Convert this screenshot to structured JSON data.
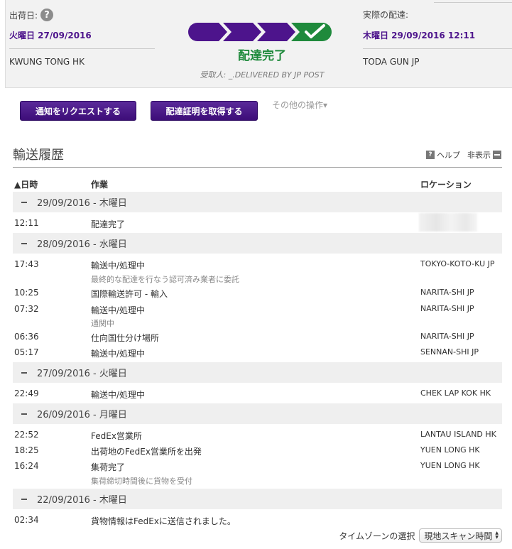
{
  "summary": {
    "ship_label": "出荷日:",
    "ship_date": "火曜日 27/09/2016",
    "origin": "KWUNG TONG HK",
    "actual_label": "実際の配達:",
    "delivery_date": "木曜日 29/09/2016 12:11",
    "destination": "TODA GUN JP",
    "status": "配達完了",
    "recipient": "受取人: _.DELIVERED BY JP POST",
    "help_icon_glyph": "?"
  },
  "actions": {
    "notify_label": "通知をリクエストする",
    "proof_label": "配達証明を取得する",
    "more_label": "その他の操作▾"
  },
  "history": {
    "title": "輸送履歴",
    "help_label": "ヘルプ",
    "hide_label": "非表示",
    "col_date": "▲日時",
    "col_activity": "作業",
    "col_location": "ロケーション",
    "days": [
      {
        "label": "29/09/2016 - 木曜日"
      },
      {
        "label": "28/09/2016 - 水曜日"
      },
      {
        "label": "27/09/2016 - 火曜日"
      },
      {
        "label": "26/09/2016 - 月曜日"
      },
      {
        "label": "22/09/2016 - 木曜日"
      }
    ],
    "events": [
      {
        "time": "12:11",
        "activity": "配達完了",
        "location": ""
      },
      {
        "time": "17:43",
        "activity": "輸送中/処理中",
        "sub": "最終的な配達を行なう認可済み業者に委託",
        "location": "TOKYO-KOTO-KU JP"
      },
      {
        "time": "10:25",
        "activity": "国際輸送許可 - 輸入",
        "location": "NARITA-SHI JP"
      },
      {
        "time": "07:32",
        "activity": "輸送中/処理中",
        "sub": "通関中",
        "location": "NARITA-SHI JP"
      },
      {
        "time": "06:36",
        "activity": "仕向国仕分け場所",
        "location": "NARITA-SHI JP"
      },
      {
        "time": "05:17",
        "activity": "輸送中/処理中",
        "location": "SENNAN-SHI JP"
      },
      {
        "time": "22:49",
        "activity": "輸送中/処理中",
        "location": "CHEK LAP KOK HK"
      },
      {
        "time": "22:52",
        "activity": "FedEx営業所",
        "location": "LANTAU ISLAND HK"
      },
      {
        "time": "18:25",
        "activity": "出荷地のFedEx営業所を出発",
        "location": "YUEN LONG HK"
      },
      {
        "time": "16:24",
        "activity": "集荷完了",
        "sub": "集荷締切時間後に貨物を受付",
        "location": "YUEN LONG HK"
      },
      {
        "time": "02:34",
        "activity": "貨物情報はFedExに送信されました。",
        "location": ""
      }
    ]
  },
  "timezone": {
    "label": "タイムゾーンの選択",
    "selected": "現地スキャン時間"
  },
  "colors": {
    "brand_purple": "#4d148c",
    "delivered_green": "#1f8a3c"
  }
}
